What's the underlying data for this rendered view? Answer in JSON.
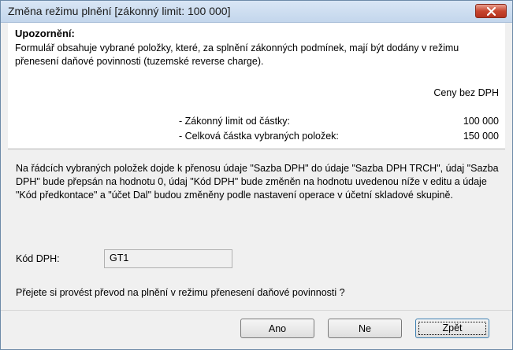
{
  "window": {
    "title": "Změna režimu plnění [zákonný limit: 100 000]",
    "close_icon": "close-icon"
  },
  "warning": {
    "heading": "Upozornění:",
    "text": "Formulář obsahuje vybrané položky, které, za splnění zákonných podmínek, mají být dodány v režimu přenesení daňové povinnosti (tuzemské reverse charge).",
    "price_header": "Ceny bez DPH",
    "rows": [
      {
        "label": "- Zákonný limit od částky:",
        "value": "100 000"
      },
      {
        "label": "- Celková částka vybraných položek:",
        "value": "150 000"
      }
    ]
  },
  "info": {
    "text": "Na řádcích vybraných položek dojde k přenosu údaje \"Sazba DPH\" do údaje \"Sazba DPH TRCH\", údaj \"Sazba DPH\" bude přepsán na hodnotu 0, údaj \"Kód DPH\" bude změněn na hodnotu uvedenou níže v editu a údaje \"Kód předkontace\" a \"účet Dal\" budou změněny podle nastavení operace v účetní skladové skupině."
  },
  "kod_dph": {
    "label": "Kód DPH:",
    "value": "GT1"
  },
  "question": "Přejete si provést převod na plnění v režimu přenesení daňové povinnosti ?",
  "buttons": {
    "yes": "Ano",
    "no": "Ne",
    "back": "Zpět"
  },
  "colors": {
    "close_button": "#c7462f",
    "titlebar": "#c3d6ec",
    "panel": "#ffffff"
  }
}
